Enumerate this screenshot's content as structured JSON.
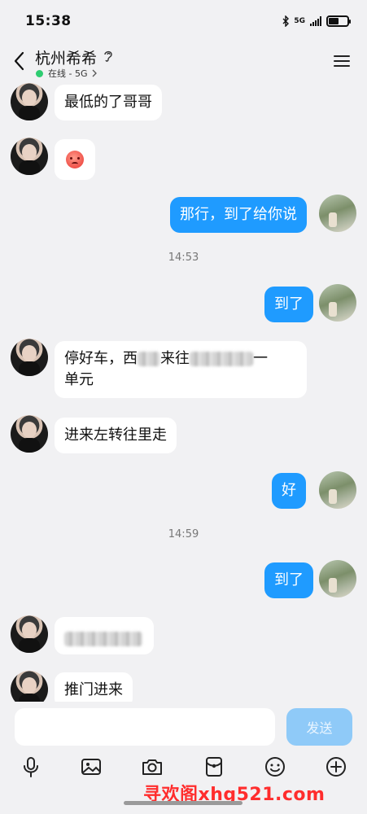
{
  "status_bar": {
    "time": "15:38",
    "network": "5G"
  },
  "header": {
    "contact_name": "杭州希希",
    "online_status": "在线 - 5G"
  },
  "messages": [
    {
      "side": "in",
      "text": "最低的了哥哥"
    },
    {
      "side": "in",
      "emoji": "angry-face"
    },
    {
      "side": "out",
      "text": "那行，到了给你说"
    },
    {
      "timestamp": "14:53"
    },
    {
      "side": "out",
      "text": "到了"
    },
    {
      "side": "in",
      "text_line1_a": "停好车，西",
      "text_line1_b": "来往",
      "text_line1_c": "一",
      "text_line2": "单元"
    },
    {
      "side": "in",
      "text": "进来左转往里走"
    },
    {
      "side": "out",
      "text": "好"
    },
    {
      "timestamp": "14:59"
    },
    {
      "side": "out",
      "text": "到了"
    },
    {
      "side": "in",
      "redacted": true
    },
    {
      "side": "in",
      "text": "推门进来"
    }
  ],
  "input": {
    "placeholder": "",
    "send_label": "发送"
  },
  "toolbar": [
    "microphone-icon",
    "image-icon",
    "camera-icon",
    "red-packet-icon",
    "emoji-icon",
    "plus-icon"
  ],
  "watermark": "寻欢阁xhg521.com",
  "colors": {
    "outgoing_bubble": "#1f9bff",
    "send_button": "#8fcaf8",
    "online_dot": "#2ecc71"
  }
}
